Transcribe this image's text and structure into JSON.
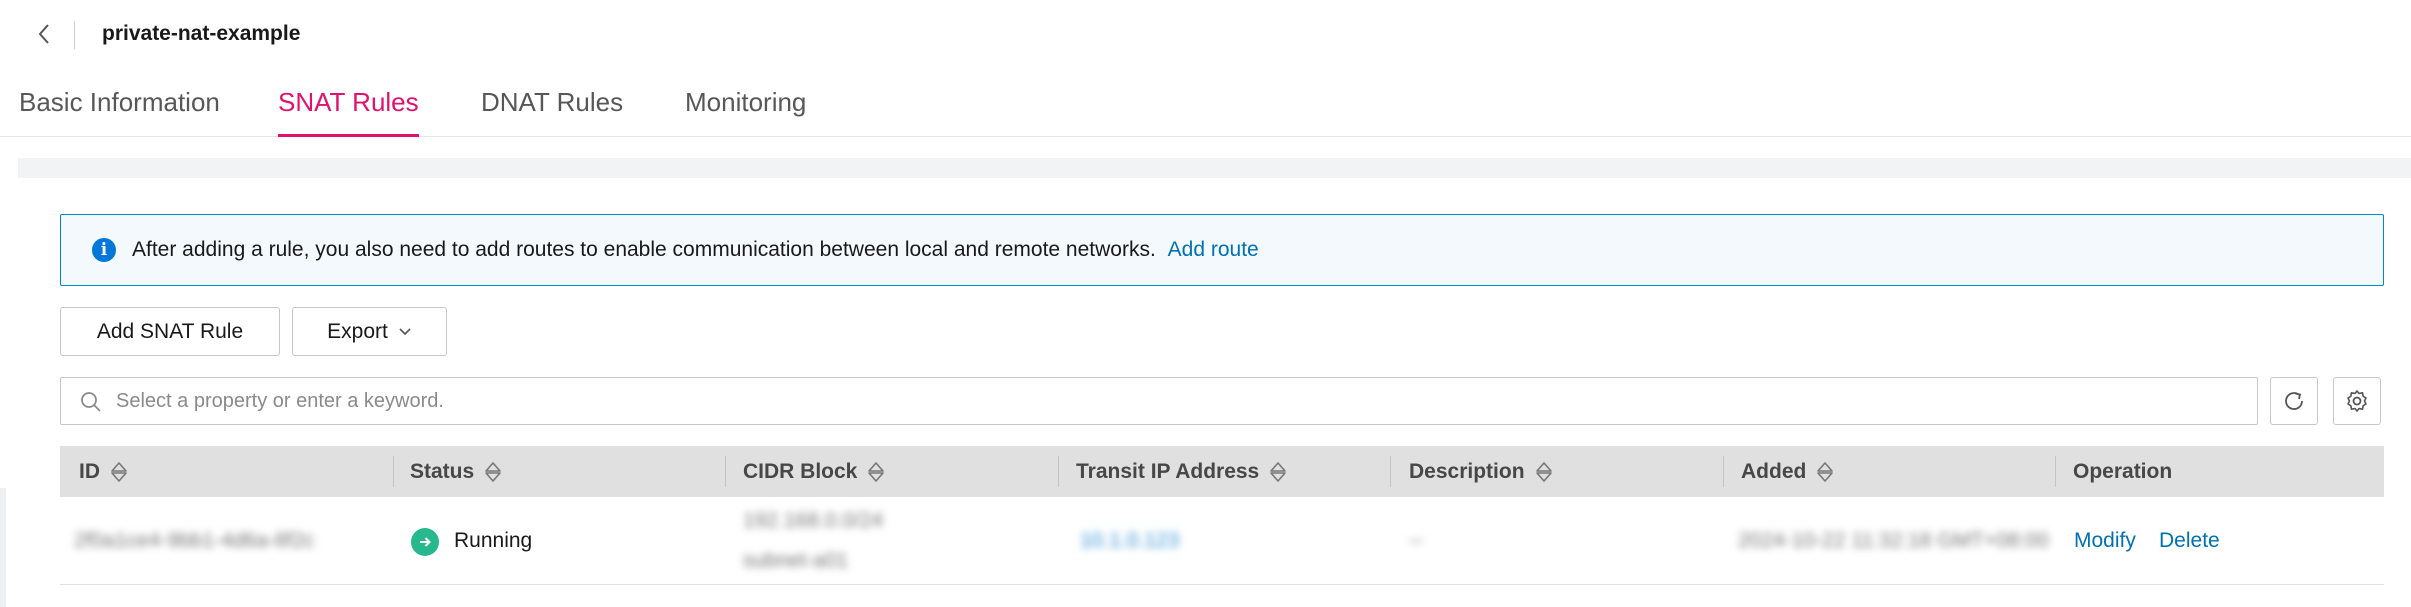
{
  "header": {
    "title": "private-nat-example"
  },
  "tabs": [
    {
      "label": "Basic Information",
      "active": false
    },
    {
      "label": "SNAT Rules",
      "active": true
    },
    {
      "label": "DNAT Rules",
      "active": false
    },
    {
      "label": "Monitoring",
      "active": false
    }
  ],
  "notice": {
    "text": "After adding a rule, you also need to add routes to enable communication between local and remote networks.",
    "link": "Add route"
  },
  "toolbar": {
    "add_label": "Add SNAT Rule",
    "export_label": "Export"
  },
  "search": {
    "placeholder": "Select a property or enter a keyword."
  },
  "table": {
    "columns": [
      "ID",
      "Status",
      "CIDR Block",
      "Transit IP Address",
      "Description",
      "Added",
      "Operation"
    ],
    "rows": [
      {
        "id": "2f0a1ce4-9bb1-4d6a-8f2c",
        "status": "Running",
        "cidr_line1": "192.168.0.0/24",
        "cidr_line2": "subnet-a01",
        "transit_ip": "10.1.0.123",
        "description": "--",
        "added": "2024-10-22 11:32:18 GMT+08:00",
        "operations": [
          "Modify",
          "Delete"
        ]
      }
    ]
  },
  "colors": {
    "accent": "#e0116f",
    "link": "#0071b3",
    "running": "#28b88d",
    "info": "#0077d9"
  }
}
